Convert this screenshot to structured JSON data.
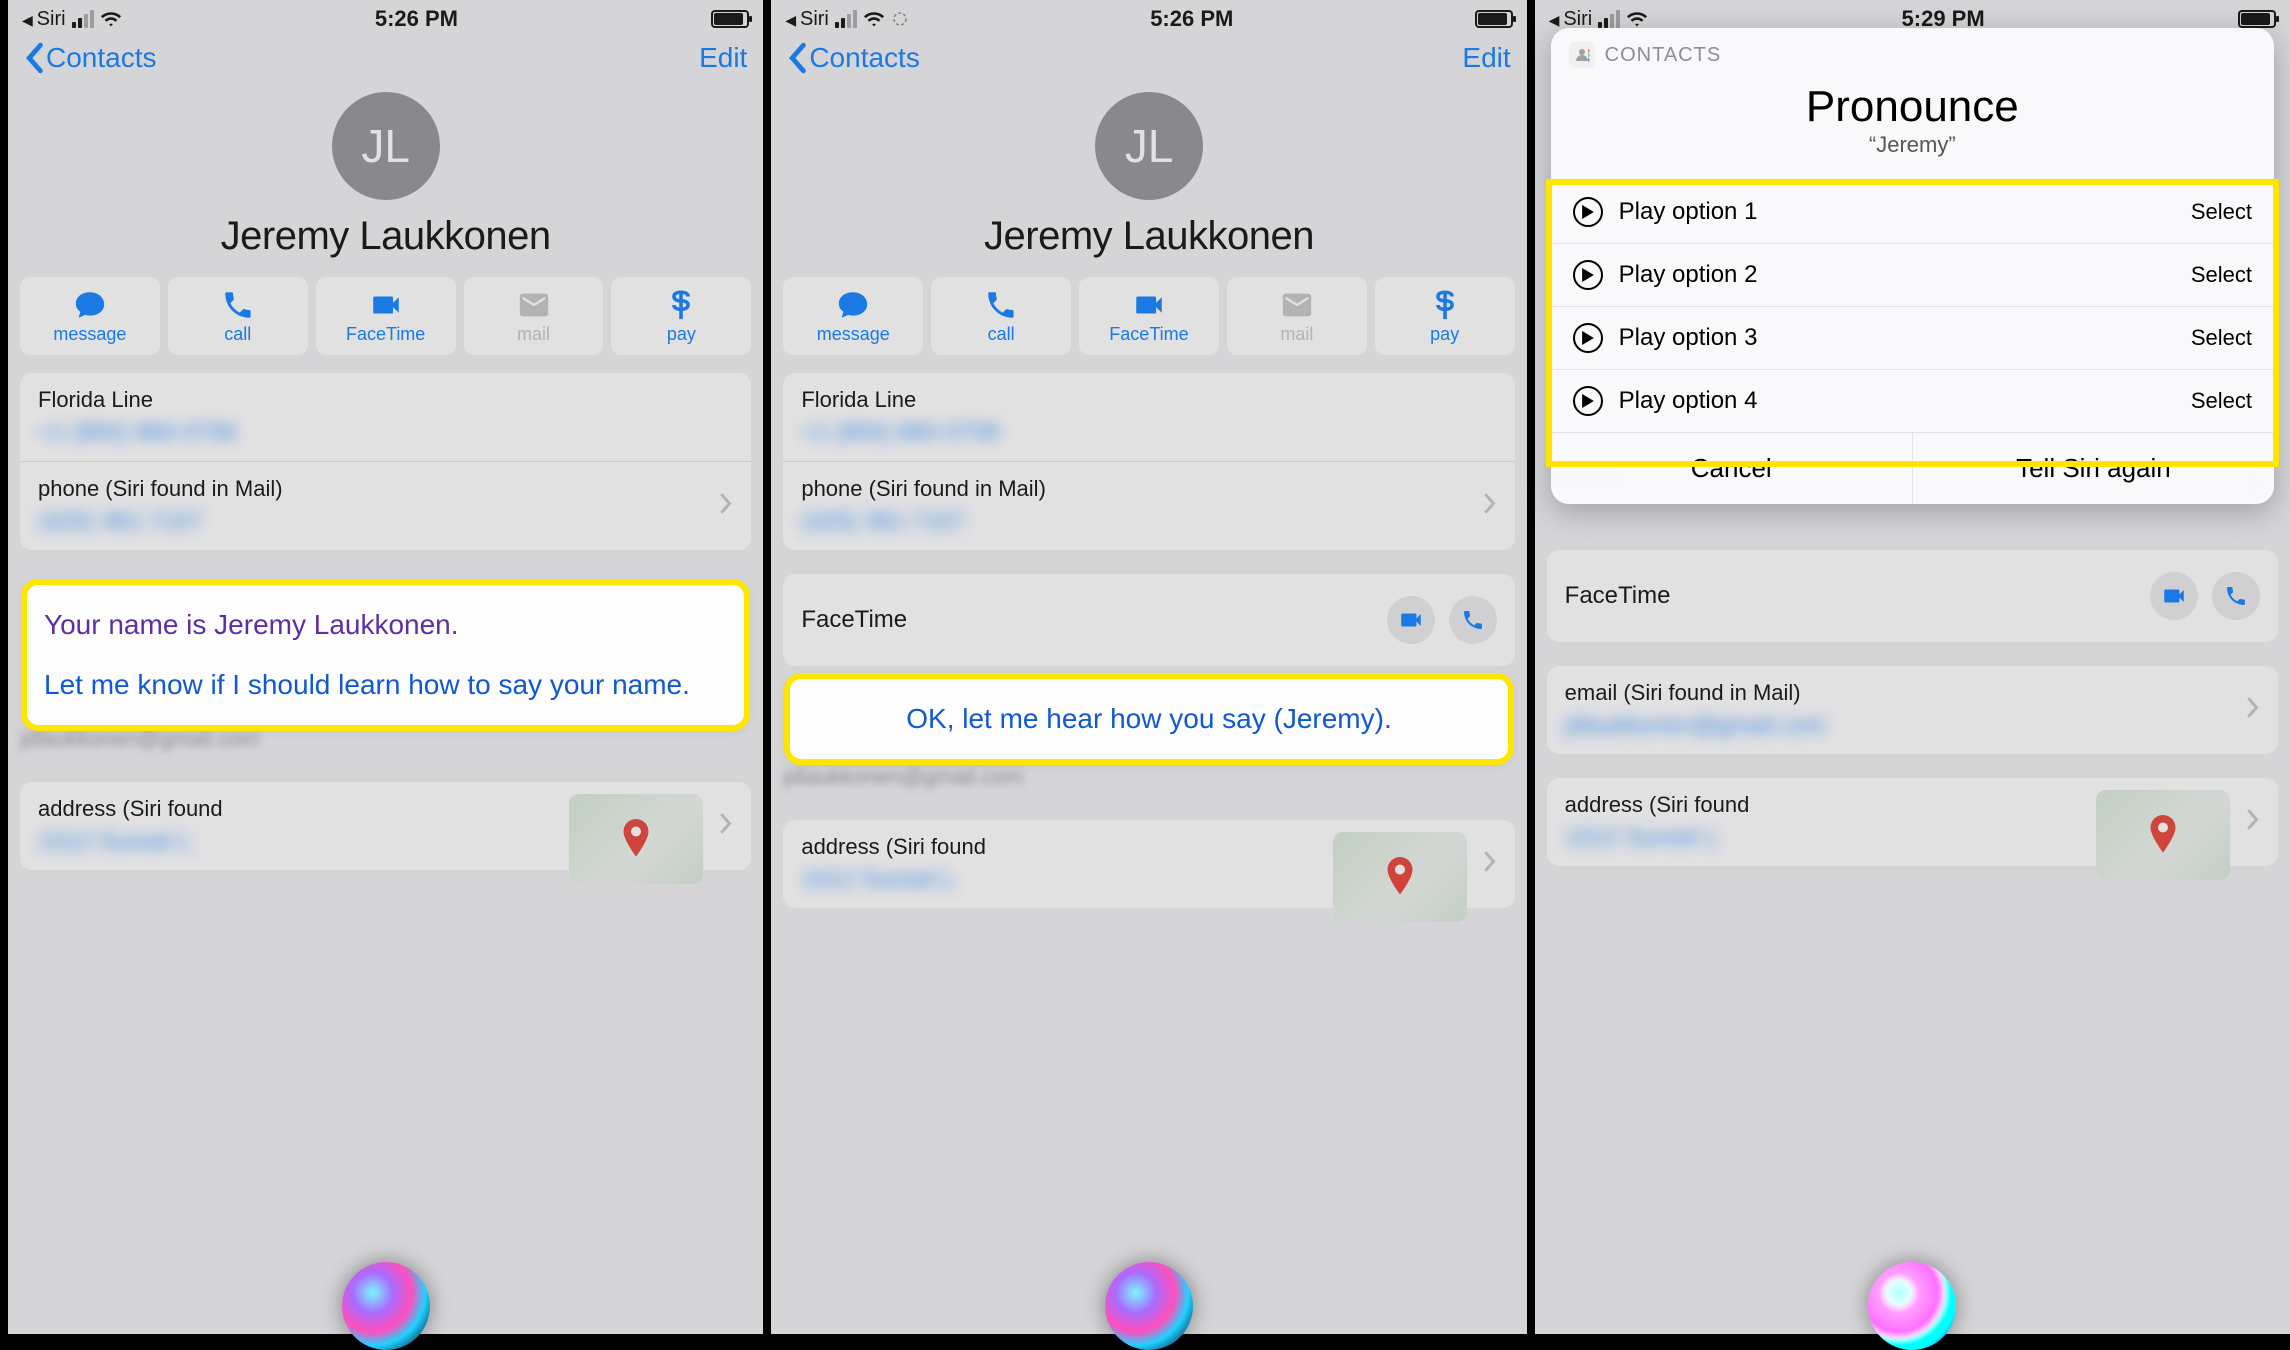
{
  "status": {
    "siri_back": "Siri",
    "time1": "5:26 PM",
    "time2": "5:26 PM",
    "time3": "5:29 PM"
  },
  "nav": {
    "back": "Contacts",
    "edit": "Edit"
  },
  "contact": {
    "initials": "JL",
    "name": "Jeremy Laukkonen"
  },
  "actions": {
    "message": "message",
    "call": "call",
    "facetime": "FaceTime",
    "mail": "mail",
    "pay": "pay"
  },
  "fields": {
    "phone1_label": "Florida Line",
    "phone1_value": "+1 (850) 860-0708",
    "phone2_label": "phone (Siri found in Mail)",
    "phone2_value": "(425) 381-7107",
    "facetime_label": "FaceTime",
    "email_label": "email (Siri found in Mail)",
    "email_value": "jdlaukkonen@gmail.com",
    "address_label": "address (Siri found"
  },
  "siri": {
    "bubble1_line1": "Your name is Jeremy Laukkonen.",
    "bubble1_line2": "Let me know if I should learn how to say your name.",
    "bubble2": "OK, let me hear how you say (Jeremy)."
  },
  "modal": {
    "app": "CONTACTS",
    "title": "Pronounce",
    "subtitle": "“Jeremy”",
    "options": [
      "Play option 1",
      "Play option 2",
      "Play option 3",
      "Play option 4"
    ],
    "select": "Select",
    "cancel": "Cancel",
    "again": "Tell Siri again"
  }
}
